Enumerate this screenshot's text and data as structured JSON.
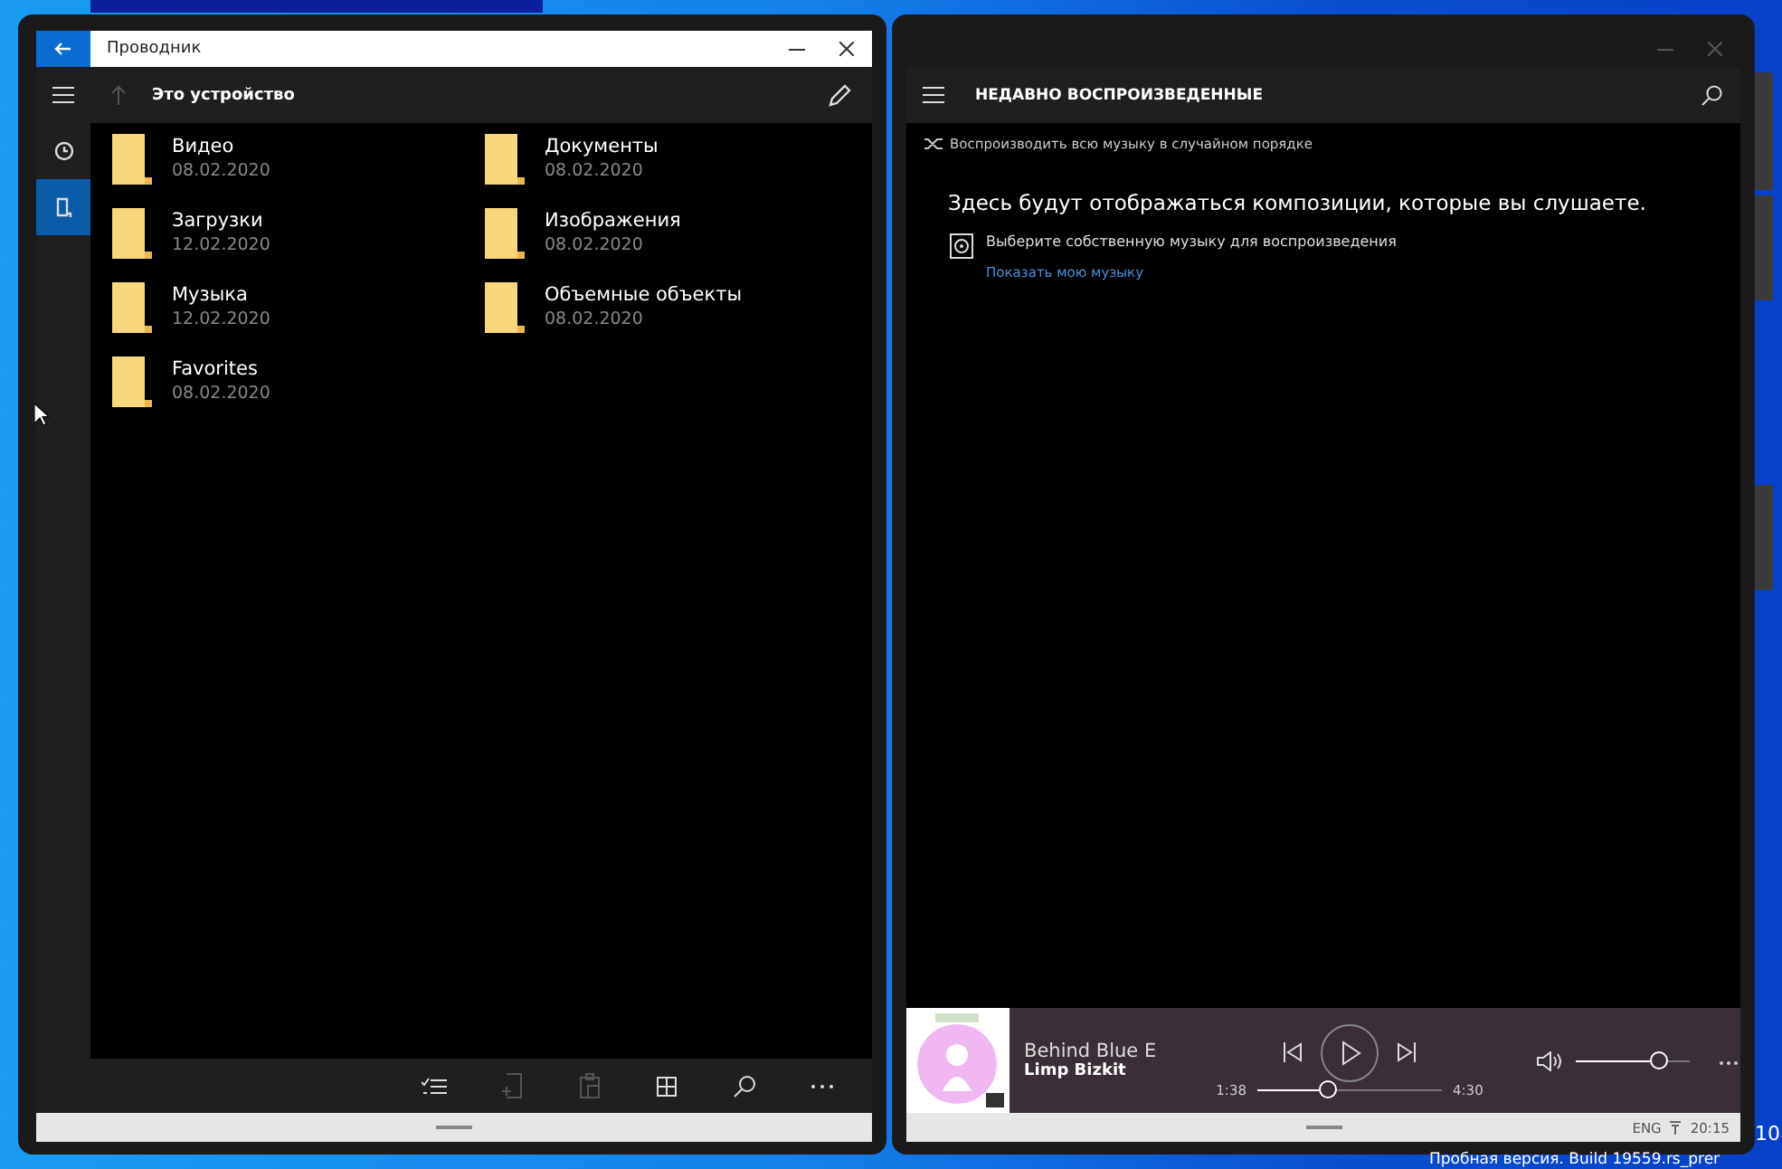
{
  "explorer": {
    "title": "Проводник",
    "location": "Это устройство",
    "nav": [
      {
        "selected": false
      },
      {
        "selected": true
      }
    ],
    "folders": [
      {
        "name": "Видео",
        "date": "08.02.2020"
      },
      {
        "name": "Документы",
        "date": "08.02.2020"
      },
      {
        "name": "Загрузки",
        "date": "12.02.2020"
      },
      {
        "name": "Изображения",
        "date": "08.02.2020"
      },
      {
        "name": "Музыка",
        "date": "12.02.2020"
      },
      {
        "name": "Объемные объекты",
        "date": "08.02.2020"
      },
      {
        "name": "Favorites",
        "date": "08.02.2020"
      }
    ]
  },
  "music": {
    "header": "НЕДАВНО ВОСПРОИЗВЕДЕННЫЕ",
    "shuffle": "Воспроизводить всю музыку в случайном порядке",
    "empty_message": "Здесь будут отображаться композиции, которые вы слушаете.",
    "choose": "Выберите собственную музыку для воспроизведения",
    "link": "Показать мою музыку",
    "player": {
      "title": "Behind Blue E",
      "artist": "Limp Bizkit",
      "elapsed": "1:38",
      "duration": "4:30",
      "progress": {
        "level": 0.38
      },
      "volume": {
        "level": 0.73
      }
    }
  },
  "status": {
    "language": "ENG",
    "time": "20:15"
  },
  "desktop": {
    "version_number": "10",
    "watermark": "Пробная версия. Build 19559.rs_prer"
  }
}
